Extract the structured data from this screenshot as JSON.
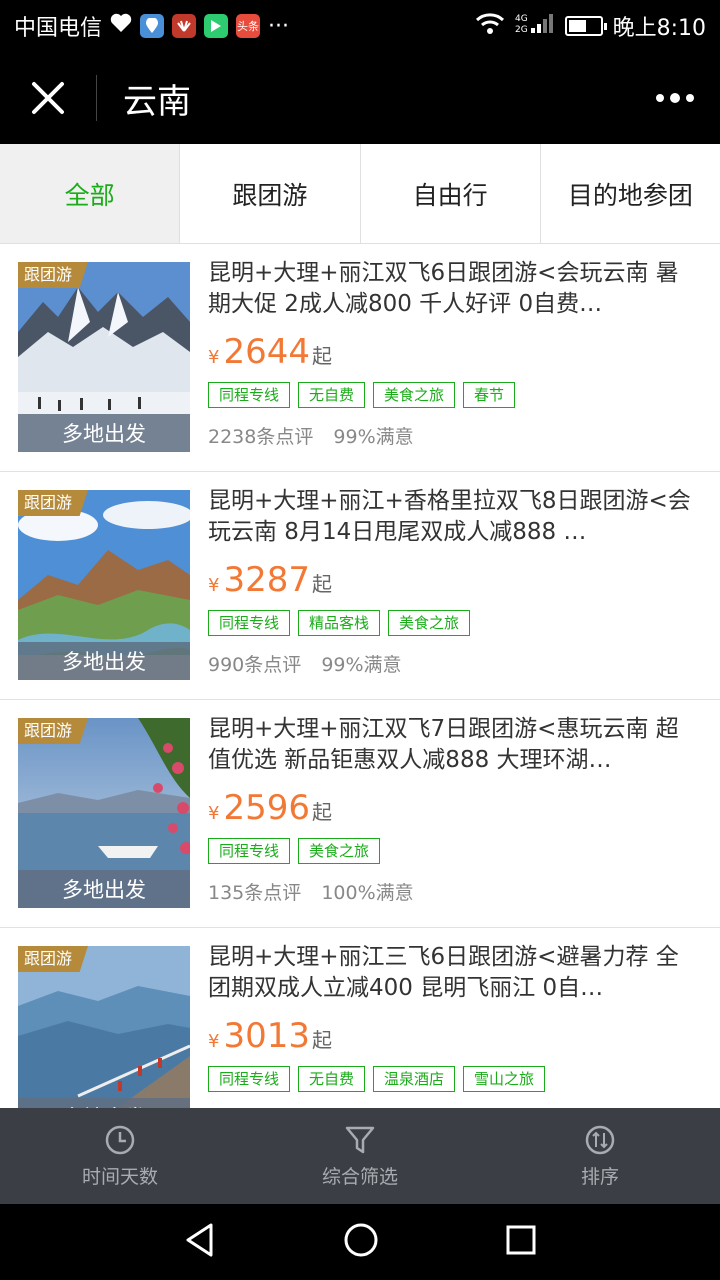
{
  "status": {
    "carrier": "中国电信",
    "time": "晚上8:10",
    "network": "4G 2G",
    "battery_level": 0.55,
    "ellipsis": "···",
    "notif_badge": "头条"
  },
  "nav": {
    "title": "云南"
  },
  "tabs": [
    {
      "label": "全部",
      "active": true
    },
    {
      "label": "跟团游"
    },
    {
      "label": "自由行"
    },
    {
      "label": "目的地参团"
    }
  ],
  "products": [
    {
      "type_tag": "跟团游",
      "origin": "多地出发",
      "title": "昆明+大理+丽江双飞6日跟团游<会玩云南 暑期大促 2成人减800 千人好评 0自费…",
      "currency": "¥",
      "price": "2644",
      "price_suffix": "起",
      "tags": [
        "同程专线",
        "无自费",
        "美食之旅",
        "春节"
      ],
      "reviews": "2238条点评",
      "satisfaction": "99%满意"
    },
    {
      "type_tag": "跟团游",
      "origin": "多地出发",
      "title": "昆明+大理+丽江+香格里拉双飞8日跟团游<会玩云南 8月14日甩尾双成人减888 …",
      "currency": "¥",
      "price": "3287",
      "price_suffix": "起",
      "tags": [
        "同程专线",
        "精品客栈",
        "美食之旅"
      ],
      "reviews": "990条点评",
      "satisfaction": "99%满意"
    },
    {
      "type_tag": "跟团游",
      "origin": "多地出发",
      "title": "昆明+大理+丽江双飞7日跟团游<惠玩云南 超值优选 新品钜惠双人减888 大理环湖…",
      "currency": "¥",
      "price": "2596",
      "price_suffix": "起",
      "tags": [
        "同程专线",
        "美食之旅"
      ],
      "reviews": "135条点评",
      "satisfaction": "100%满意"
    },
    {
      "type_tag": "跟团游",
      "origin": "多地出发",
      "title": "昆明+大理+丽江三飞6日跟团游<避暑力荐 全团期双成人立减400 昆明飞丽江 0自…",
      "currency": "¥",
      "price": "3013",
      "price_suffix": "起",
      "tags": [
        "同程专线",
        "无自费",
        "温泉酒店",
        "雪山之旅"
      ],
      "reviews": "",
      "satisfaction": ""
    }
  ],
  "toolbar": [
    {
      "label": "时间天数",
      "icon": "clock-icon"
    },
    {
      "label": "综合筛选",
      "icon": "filter-icon"
    },
    {
      "label": "排序",
      "icon": "sort-icon"
    }
  ],
  "colors": {
    "accent": "#1aad19",
    "price": "#f27935",
    "toolbar_bg": "#3b3f45"
  }
}
